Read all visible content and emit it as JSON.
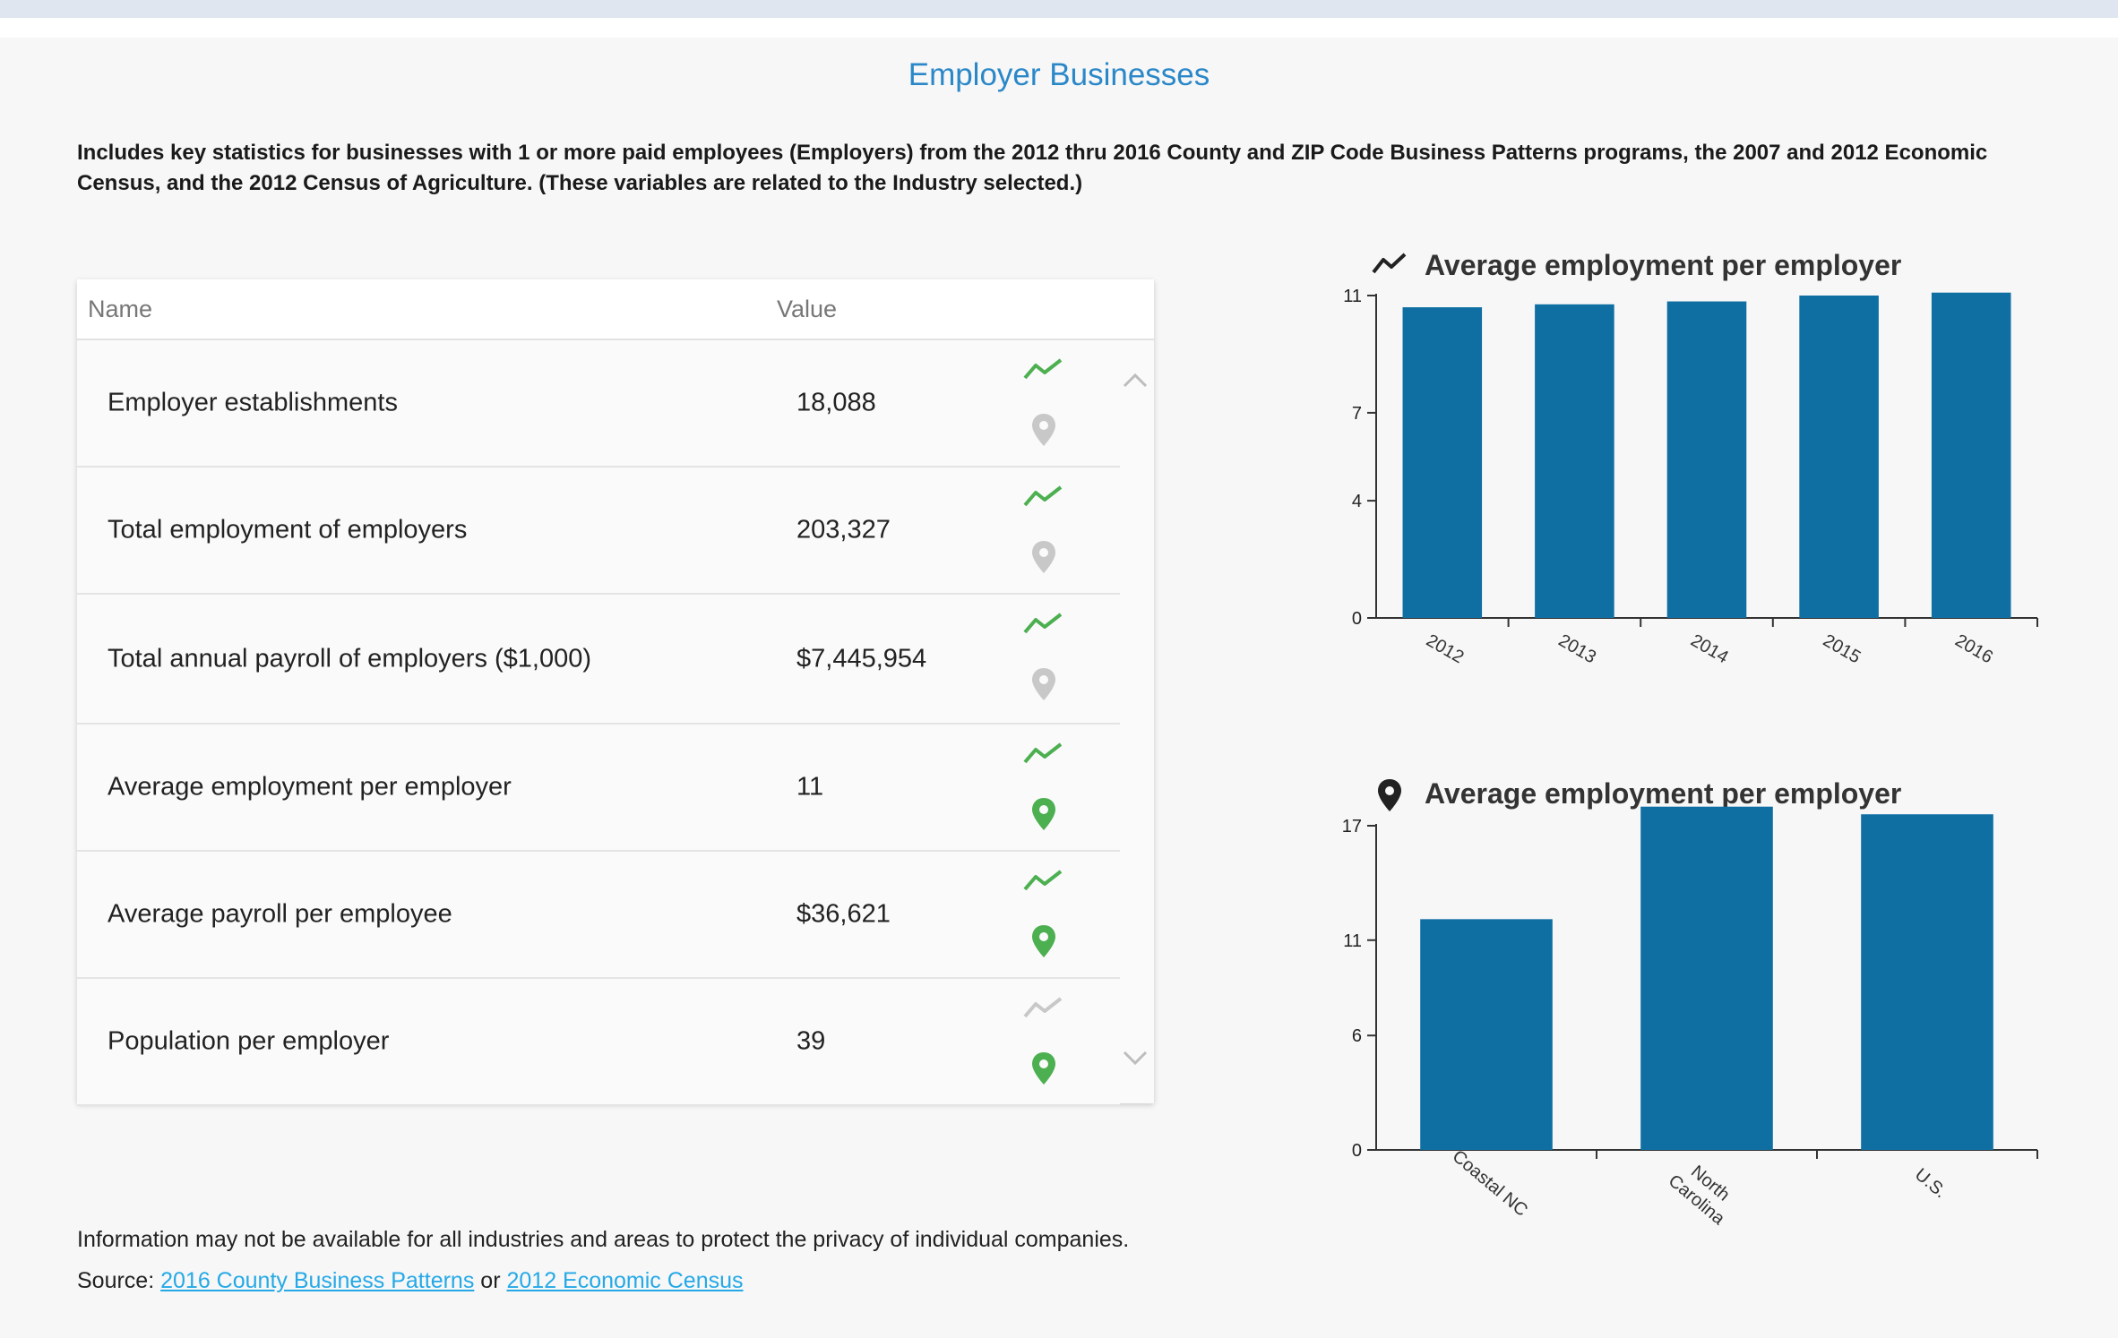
{
  "page": {
    "title": "Employer Businesses",
    "intro": "Includes key statistics for businesses with 1 or more paid employees (Employers) from the 2012 thru 2016 County and ZIP Code Business Patterns programs, the 2007 and 2012 Economic Census, and the 2012 Census of Agriculture. (These variables are related to the Industry selected.)",
    "note": "Information may not be available for all industries and areas to protect the privacy of individual companies.",
    "source_label": "Source:",
    "source_link1": "2016 County Business Patterns",
    "source_or": "or",
    "source_link2": "2012 Economic Census"
  },
  "table": {
    "headers": {
      "name": "Name",
      "value": "Value"
    },
    "rows": [
      {
        "name": "Employer establishments",
        "value": "18,088",
        "trend_active": true,
        "map_active": false
      },
      {
        "name": "Total employment of employers",
        "value": "203,327",
        "trend_active": true,
        "map_active": false
      },
      {
        "name": "Total annual payroll of employers ($1,000)",
        "value": "$7,445,954",
        "trend_active": true,
        "map_active": false
      },
      {
        "name": "Average employment per employer",
        "value": "11",
        "trend_active": true,
        "map_active": true
      },
      {
        "name": "Average payroll per employee",
        "value": "$36,621",
        "trend_active": true,
        "map_active": true
      },
      {
        "name": "Population per employer",
        "value": "39",
        "trend_active": false,
        "map_active": true
      }
    ],
    "icons": {
      "trend": "trend-line-icon",
      "map": "map-pin-icon",
      "up": "chevron-up-icon",
      "down": "chevron-down-icon"
    }
  },
  "colors": {
    "bar": "#0f6fa3",
    "active_icon": "#4caf50",
    "inactive_icon": "#c8c8c8",
    "title": "#2b88c8",
    "link": "#25a9e6"
  },
  "chart_data": [
    {
      "type": "bar",
      "title": "Average employment per employer",
      "icon": "trend-line-icon",
      "categories": [
        "2012",
        "2013",
        "2014",
        "2015",
        "2016"
      ],
      "values": [
        10.6,
        10.7,
        10.8,
        11.0,
        11.1
      ],
      "ylim": [
        0,
        11
      ],
      "yticks": [
        0,
        4,
        7,
        11
      ],
      "xlabel": "",
      "ylabel": ""
    },
    {
      "type": "bar",
      "title": "Average employment per employer",
      "icon": "map-pin-icon",
      "categories": [
        "Coastal NC",
        "North Carolina",
        "U.S."
      ],
      "values": [
        12.1,
        18.0,
        17.6
      ],
      "ylim": [
        0,
        17
      ],
      "yticks": [
        0,
        6,
        11,
        17
      ],
      "xlabel": "",
      "ylabel": ""
    }
  ]
}
